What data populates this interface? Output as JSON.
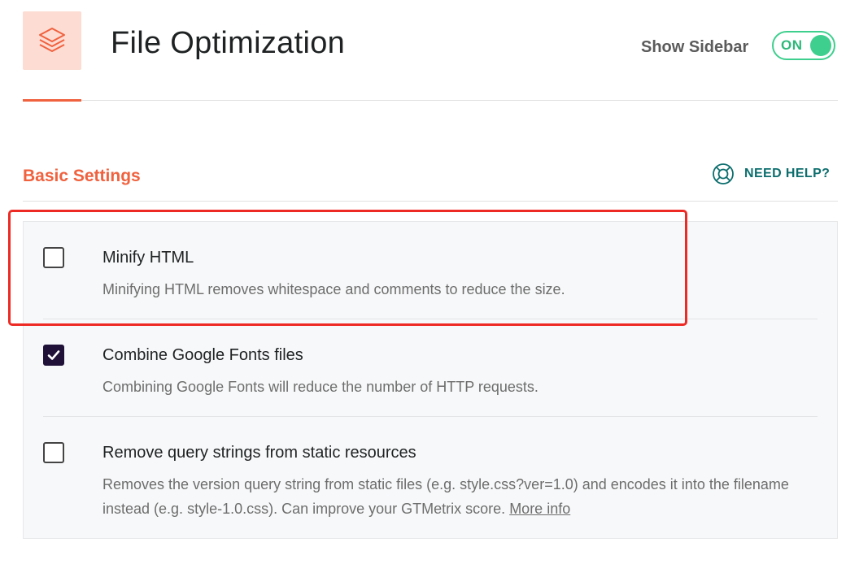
{
  "header": {
    "title": "File Optimization",
    "icon": "layers-icon",
    "sidebar_label": "Show Sidebar",
    "toggle_label": "ON"
  },
  "section": {
    "title": "Basic Settings",
    "help_label": "NEED HELP?",
    "help_icon": "lifebuoy-icon"
  },
  "options": [
    {
      "title": "Minify HTML",
      "description": "Minifying HTML removes whitespace and comments to reduce the size.",
      "checked": false
    },
    {
      "title": "Combine Google Fonts files",
      "description": "Combining Google Fonts will reduce the number of HTTP requests.",
      "checked": true
    },
    {
      "title": "Remove query strings from static resources",
      "description": "Removes the version query string from static files (e.g. style.css?ver=1.0) and encodes it into the filename instead (e.g. style-1.0.css). Can improve your GTMetrix score.",
      "link": "More info",
      "checked": false
    }
  ],
  "colors": {
    "accent": "#f0613e",
    "toggle_on": "#3ecf8e",
    "help": "#0d6e6e",
    "checkbox_checked": "#1f1138",
    "highlight": "#ee2a24"
  }
}
